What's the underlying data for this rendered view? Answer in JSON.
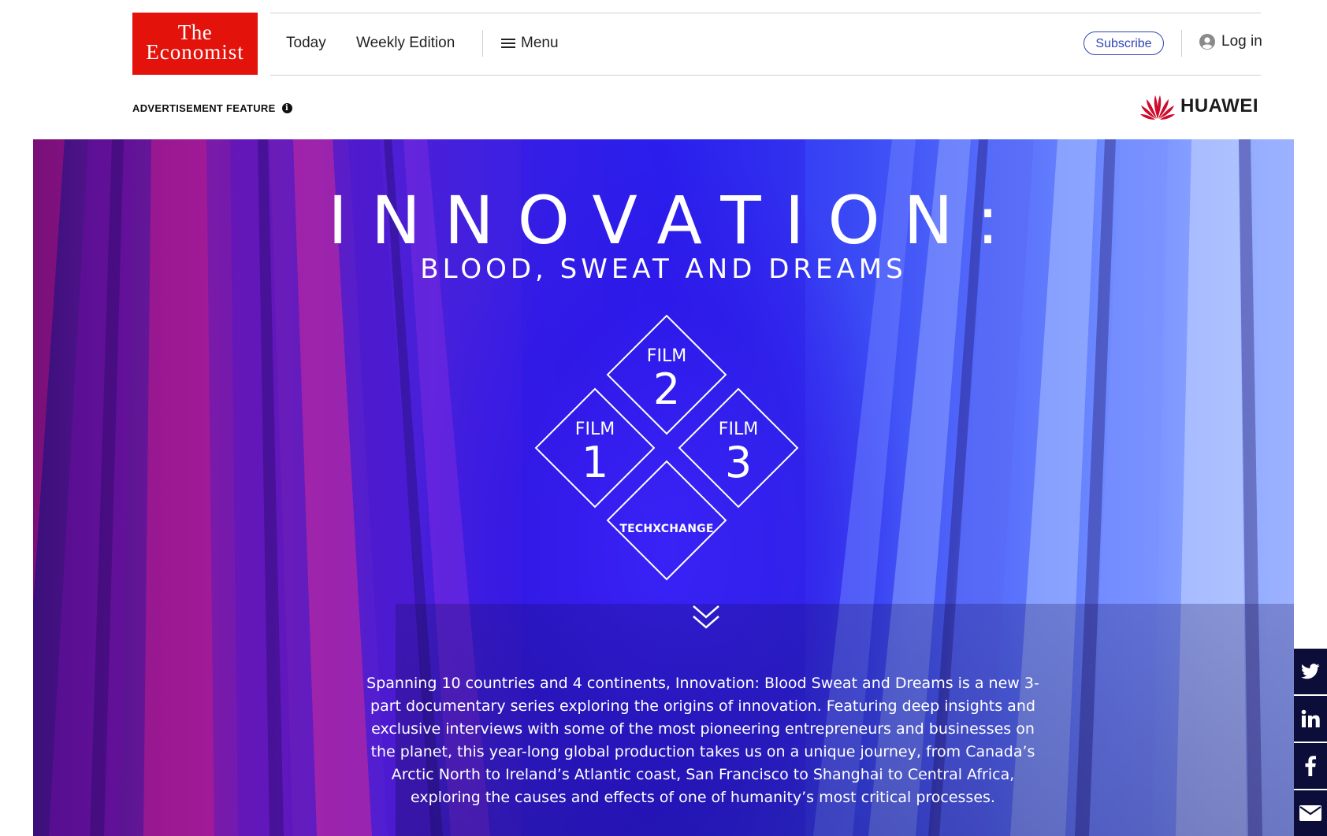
{
  "header": {
    "logo": {
      "line1": "The",
      "line2": "Economist"
    },
    "nav": {
      "today": "Today",
      "weekly_edition": "Weekly Edition",
      "menu": "Menu"
    },
    "subscribe_label": "Subscribe",
    "login_label": "Log in"
  },
  "ad_bar": {
    "label": "ADVERTISEMENT FEATURE",
    "info_glyph": "i",
    "sponsor": "HUAWEI"
  },
  "hero": {
    "title": "INNOVATION:",
    "subtitle": "BLOOD, SWEAT AND DREAMS",
    "films": [
      {
        "prefix": "FILM",
        "number": "1"
      },
      {
        "prefix": "FILM",
        "number": "2"
      },
      {
        "prefix": "FILM",
        "number": "3"
      }
    ],
    "techxchange_label": "TECHXCHANGE",
    "description": "Spanning 10 countries and 4 continents, Innovation: Blood Sweat and Dreams is a new 3-part documentary series exploring the origins of innovation. Featuring deep insights and exclusive interviews with some of the most pioneering entrepreneurs and businesses on the planet, this year-long global production takes us on a unique journey, from Canada’s Arctic North to Ireland’s Atlantic coast, San Francisco to Shanghai to Central Africa, exploring the causes and effects of one of humanity’s most critical processes."
  },
  "share": {
    "icons": [
      "twitter-icon",
      "linkedin-icon",
      "facebook-icon",
      "email-icon"
    ]
  },
  "colors": {
    "economist_red": "#e3120b",
    "subscribe_blue": "#2e45b8",
    "huawei_red": "#cf0a2c",
    "share_bg": "#0d0d3a"
  }
}
